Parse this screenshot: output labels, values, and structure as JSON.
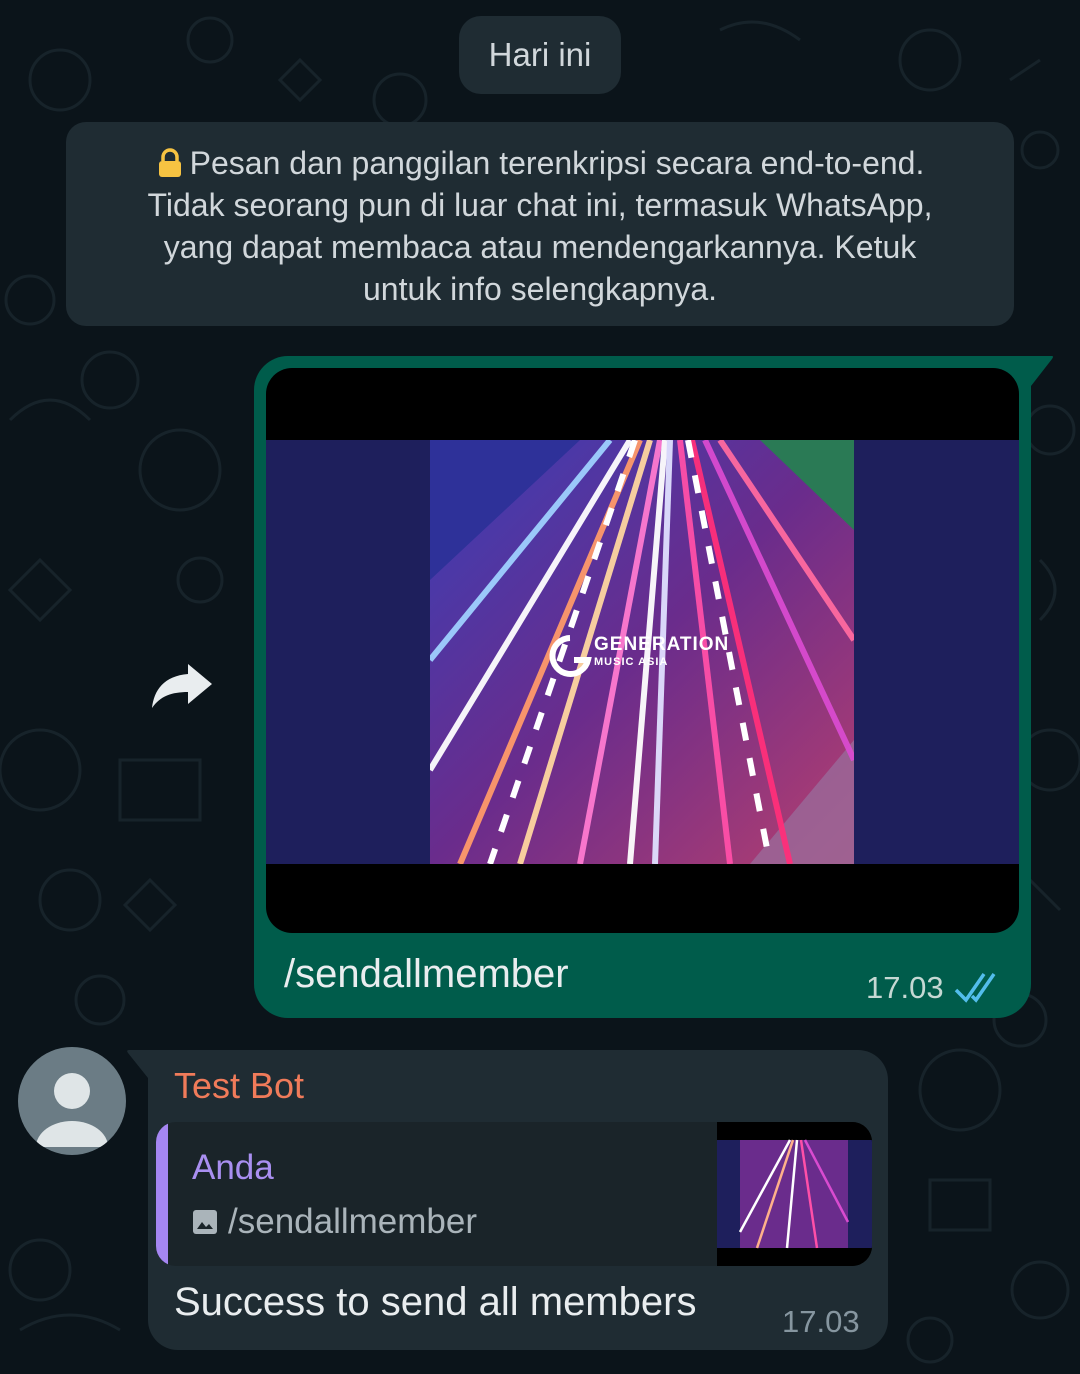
{
  "date_chip": "Hari ini",
  "encryption_notice": {
    "icon": "lock-icon",
    "lines": [
      "Pesan dan panggilan terenkripsi secara end-to-end.",
      "Tidak seorang pun di luar chat ini, termasuk WhatsApp,",
      "yang dapat membaca atau mendengarkannya. Ketuk",
      "untuk info selengkapnya."
    ],
    "icon_color": "#f6c342"
  },
  "outgoing_message": {
    "media_logo": {
      "brand": "GENERATION",
      "sub": "MUSIC ASIA"
    },
    "text": "/sendallmember",
    "time": "17.03",
    "status": "read",
    "status_icon": "double-check-icon",
    "bubble_color": "#005c4b",
    "tick_color": "#53bdeb"
  },
  "forward_icon": "forward-arrow-icon",
  "incoming_message": {
    "sender": "Test Bot",
    "sender_color": "#f07b5a",
    "quoted": {
      "author": "Anda",
      "text": "/sendallmember",
      "media_icon": "image-icon",
      "author_color": "#a98ff0"
    },
    "text": "Success to send all members",
    "time": "17.03",
    "avatar_icon": "default-avatar-icon"
  },
  "colors": {
    "background": "#0b141a",
    "chip": "#1f2c33",
    "incoming_bubble": "#1f2c33"
  }
}
